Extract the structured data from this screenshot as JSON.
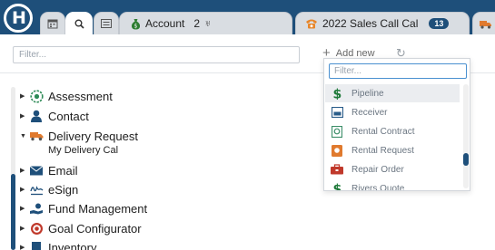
{
  "tabs": [
    {
      "name": "calendar-tab",
      "icon": "calendar-icon"
    },
    {
      "name": "search-tab",
      "icon": "search-icon",
      "active": true
    },
    {
      "name": "list-tab",
      "icon": "list-icon"
    },
    {
      "title": "Account",
      "count": "2",
      "pin": "♅",
      "icon": "money-bag-icon"
    },
    {
      "title": "2022 Sales Call Cal",
      "badge": "13",
      "icon": "phone-icon"
    },
    {
      "icon": "truck-icon"
    }
  ],
  "toolbar": {
    "filter_placeholder": "Filter...",
    "add_new_label": "Add new",
    "refresh_icon": "refresh-icon"
  },
  "modules": [
    {
      "label": "Assessment",
      "icon": "assessment-icon",
      "expanded": false
    },
    {
      "label": "Contact",
      "icon": "person-icon",
      "expanded": false
    },
    {
      "label": "Delivery Request",
      "icon": "truck-icon",
      "expanded": true,
      "children": [
        "My Delivery Cal"
      ]
    },
    {
      "label": "Email",
      "icon": "envelope-icon",
      "expanded": false
    },
    {
      "label": "eSign",
      "icon": "signature-icon",
      "expanded": false
    },
    {
      "label": "Fund Management",
      "icon": "hand-money-icon",
      "expanded": false
    },
    {
      "label": "Goal Configurator",
      "icon": "target-icon",
      "expanded": false
    },
    {
      "label": "Inventory",
      "icon": "inventory-icon",
      "expanded": false
    }
  ],
  "dropdown": {
    "filter_placeholder": "Filter...",
    "items": [
      {
        "label": "Pipeline",
        "icon": "dollar-icon",
        "color": "#1f7a3a",
        "highlighted": true
      },
      {
        "label": "Receiver",
        "icon": "receiver-icon",
        "color": "#2a5d8a"
      },
      {
        "label": "Rental Contract",
        "icon": "contract-icon",
        "color": "#3e8f6a"
      },
      {
        "label": "Rental Request",
        "icon": "rental-request-icon",
        "color": "#e07a2e"
      },
      {
        "label": "Repair Order",
        "icon": "toolbox-icon",
        "color": "#c0392b"
      },
      {
        "label": "Rivers Quote",
        "icon": "dollar-icon",
        "color": "#1f7a3a"
      }
    ]
  },
  "colors": {
    "brand": "#1e4f7a",
    "highlight": "#ebedf0"
  }
}
